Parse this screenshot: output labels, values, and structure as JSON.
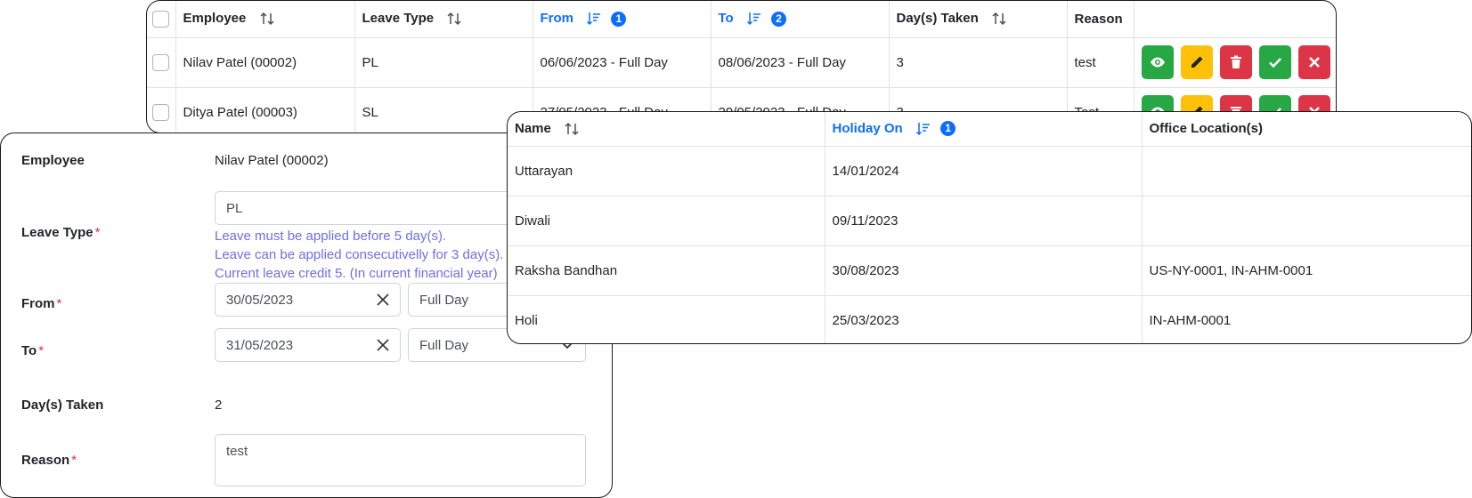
{
  "leave_table": {
    "headers": {
      "employee": "Employee",
      "leave_type": "Leave Type",
      "from": "From",
      "from_badge": "1",
      "to": "To",
      "to_badge": "2",
      "days_taken": "Day(s) Taken",
      "reason": "Reason"
    },
    "rows": [
      {
        "employee": "Nilav Patel (00002)",
        "leave_type": "PL",
        "from": "06/06/2023 - Full Day",
        "to": "08/06/2023 - Full Day",
        "days": "3",
        "reason": "test"
      },
      {
        "employee": "Ditya Patel (00003)",
        "leave_type": "SL",
        "from": "27/05/2023 - Full Day",
        "to": "29/05/2023 - Full Day",
        "days": "3",
        "reason": "Test"
      }
    ],
    "action_icons": [
      "eye-icon",
      "pencil-icon",
      "trash-icon",
      "check-icon",
      "x-icon"
    ],
    "colors": {
      "view": "#28a745",
      "edit": "#ffc107",
      "delete": "#dc3545",
      "approve": "#28a745",
      "reject": "#dc3545",
      "sorted_header": "#0d6efd"
    }
  },
  "leave_form": {
    "employee_label": "Employee",
    "employee_value": "Nilav Patel (00002)",
    "leave_type_label": "Leave Type",
    "leave_type_value": "PL",
    "hints": [
      "Leave must be applied before 5 day(s).",
      "Leave can be applied consecutivelly for 3 day(s).",
      "Current leave credit 5. (In current financial year)"
    ],
    "from_label": "From",
    "from_date": "30/05/2023",
    "from_duration": "Full Day",
    "to_label": "To",
    "to_date": "31/05/2023",
    "to_duration": "Full Day",
    "days_label": "Day(s) Taken",
    "days_value": "2",
    "reason_label": "Reason",
    "reason_value": "test",
    "required_mark": "*"
  },
  "holiday_table": {
    "headers": {
      "name": "Name",
      "holiday_on": "Holiday On",
      "holiday_badge": "1",
      "office_locations": "Office Location(s)"
    },
    "rows": [
      {
        "name": "Uttarayan",
        "date": "14/01/2024",
        "locations": ""
      },
      {
        "name": "Diwali",
        "date": "09/11/2023",
        "locations": ""
      },
      {
        "name": "Raksha Bandhan",
        "date": "30/08/2023",
        "locations": "US-NY-0001, IN-AHM-0001"
      },
      {
        "name": "Holi",
        "date": "25/03/2023",
        "locations": "IN-AHM-0001"
      }
    ]
  }
}
